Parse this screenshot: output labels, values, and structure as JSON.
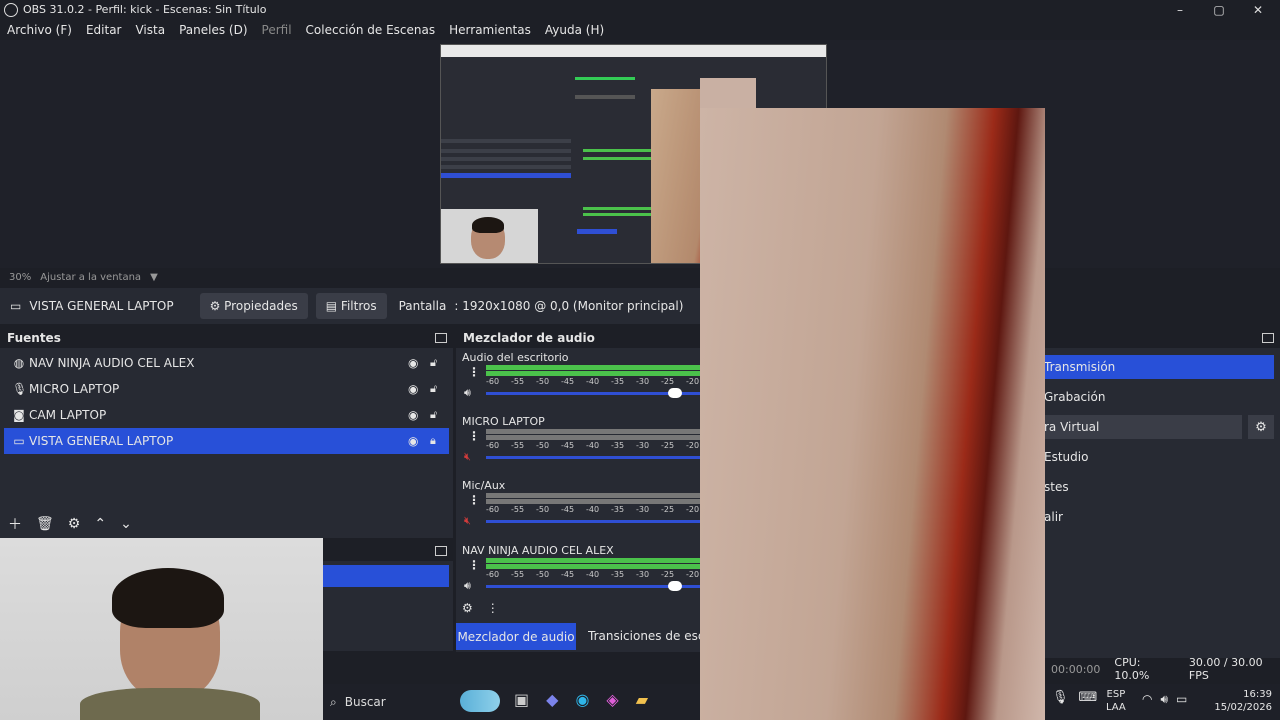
{
  "window": {
    "title": "OBS 31.0.2 - Perfil: kick - Escenas: Sin Título",
    "controls": [
      "–",
      "▢",
      "✕"
    ]
  },
  "menu": {
    "items": [
      "Archivo (F)",
      "Editar",
      "Vista",
      "Paneles (D)",
      "Perfil",
      "Colección de Escenas",
      "Herramientas",
      "Ayuda (H)"
    ]
  },
  "preview": {
    "zoom": "30%",
    "fit_label": "Ajustar a la ventana"
  },
  "source_toolbar": {
    "selected_source": "VISTA GENERAL LAPTOP",
    "properties_label": "Propiedades",
    "filters_label": "Filtros",
    "display_label": "Pantalla",
    "display_value": ": 1920x1080 @ 0,0 (Monitor principal)"
  },
  "sources": {
    "title": "Fuentes",
    "items": [
      {
        "name": "NAV NINJA AUDIO CEL ALEX",
        "icon": "globe-icon"
      },
      {
        "name": "MICRO LAPTOP",
        "icon": "microphone-icon"
      },
      {
        "name": "CAM LAPTOP",
        "icon": "camera-icon"
      },
      {
        "name": "VISTA GENERAL LAPTOP",
        "icon": "monitor-icon",
        "selected": true
      }
    ]
  },
  "mixer": {
    "title": "Mezclador de audio",
    "ticks": [
      "-60",
      "-55",
      "-50",
      "-45",
      "-40",
      "-35",
      "-30",
      "-25",
      "-20"
    ],
    "channels": [
      {
        "name": "Audio del escritorio",
        "volume": 0.88,
        "muted": false
      },
      {
        "name": "MICRO LAPTOP",
        "volume": 1.0,
        "muted": true
      },
      {
        "name": "Mic/Aux",
        "volume": 1.0,
        "muted": true
      },
      {
        "name": "NAV NINJA AUDIO CEL ALEX",
        "volume": 0.88,
        "muted": false
      }
    ],
    "tabs": [
      "Mezclador de audio",
      "Transiciones de escena"
    ]
  },
  "controls": {
    "buttons": [
      "Transmisión",
      "Grabación",
      "ra Virtual",
      "Estudio",
      "stes",
      "alir"
    ]
  },
  "status": {
    "time": "00:00:00",
    "cpu": "CPU: 10.0%",
    "fps": "30.00 / 30.00 FPS"
  },
  "taskbar": {
    "search_label": "Buscar",
    "lang": "ESP",
    "layout": "LAA",
    "time": "16:39",
    "date": "15/02/2026"
  },
  "colors": {
    "accent": "#2850d8",
    "meter_green": "#4bc24b",
    "background": "#1d1f26"
  }
}
